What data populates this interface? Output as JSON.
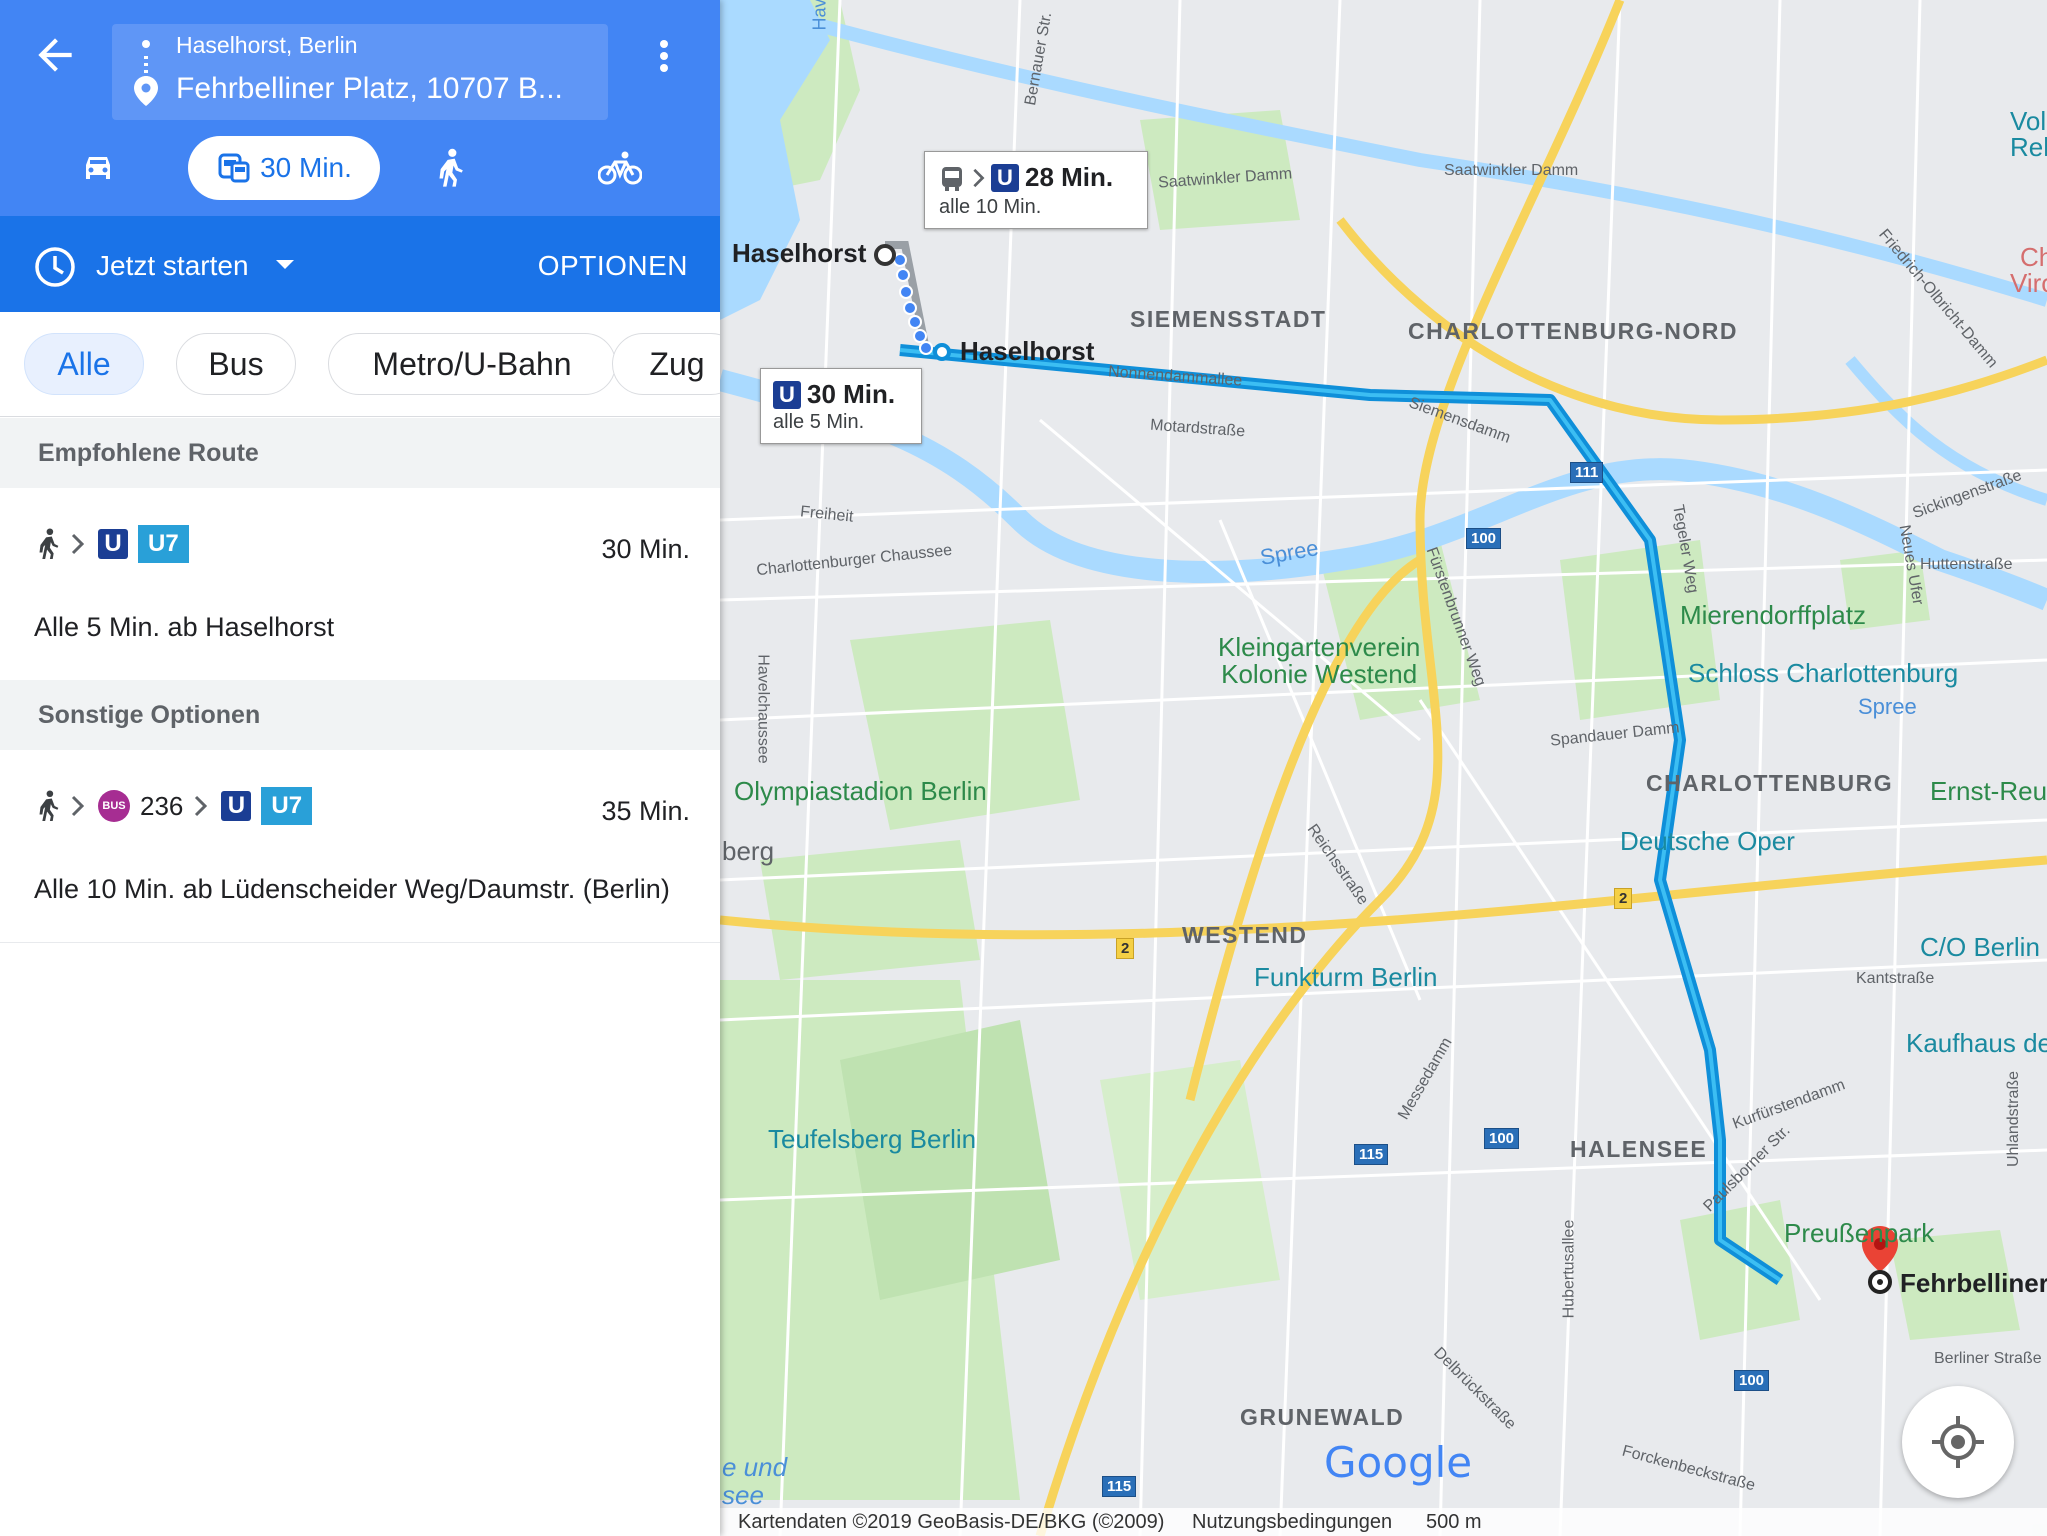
{
  "directions": {
    "origin": "Haselhorst, Berlin",
    "destination": "Fehrbelliner Platz, 10707 B...",
    "modes": [
      {
        "name": "driving",
        "icon": "car-icon"
      },
      {
        "name": "transit",
        "icon": "transit-icon",
        "label": "30 Min."
      },
      {
        "name": "walking",
        "icon": "walk-icon"
      },
      {
        "name": "cycling",
        "icon": "bicycle-icon"
      }
    ],
    "depart_label": "Jetzt starten",
    "options_label": "OPTIONEN",
    "filters": [
      "Alle",
      "Bus",
      "Metro/U-Bahn",
      "Zug"
    ]
  },
  "recommended": {
    "header": "Empfohlene Route",
    "route": {
      "line": "U7",
      "u": "U",
      "duration": "30 Min.",
      "desc": "Alle 5 Min. ab Haselhorst"
    }
  },
  "other": {
    "header": "Sonstige Optionen",
    "route": {
      "bus_badge": "BUS",
      "bus_line": "236",
      "line": "U7",
      "u": "U",
      "duration": "35 Min.",
      "desc": "Alle 10 Min. ab Lüdenscheider Weg/Daumstr. (Berlin)"
    }
  },
  "map": {
    "callout_top": {
      "u": "U",
      "time": "28 Min.",
      "freq": "alle 10 Min."
    },
    "callout_main": {
      "u": "U",
      "time": "30 Min.",
      "freq": "alle 5 Min."
    },
    "stop_origin": "Haselhorst",
    "stop_station": "Haselhorst",
    "dest": "Fehrbelliner",
    "districts": [
      "SIEMENSSTADT",
      "CHARLOTTENBURG-NORD",
      "CHARLOTTENBURG",
      "WESTEND",
      "HALENSEE",
      "GRUNEWALD"
    ],
    "streets": [
      "Saatwinkler Damm",
      "Saatwinkler Damm",
      "Nonnendammallee",
      "Motardstraße",
      "Siemensdamm",
      "Freiheit",
      "Charlottenburger Chaussee",
      "Spree",
      "Spree",
      "Fürstenbrunner Weg",
      "Spandauer Damm",
      "Havelchaussee",
      "Reichsstraße",
      "Messedamm",
      "Kurfürstendamm",
      "Paulsborner Str.",
      "Hubertusallee",
      "Delbrückstraße",
      "Forckenbeckstraße",
      "Berliner Straße",
      "Kantstraße",
      "Sickingenstraße",
      "Huttenstraße",
      "Tegeler Weg",
      "Neues Ufer",
      "Friedrich-Olbricht-Damm",
      "Bernauer Str.",
      "Uhlandstraße"
    ],
    "pois_green": [
      "Kleingartenverein\nKolonie Westend",
      "Olympiastadion Berlin",
      "Teufelsberg Berlin",
      "Mierendorffplatz",
      "Ernst-Reut",
      "Preußenpark"
    ],
    "pois_teal": [
      "Schloss Charlottenburg",
      "Deutsche Oper",
      "Funkturm Berlin",
      "C/O Berlin",
      "Kaufhaus de"
    ],
    "edge_text": [
      "Vol",
      "Reh",
      "Ch",
      "Viro",
      "berg",
      "e und",
      "see",
      "Hav"
    ],
    "highways": [
      "111",
      "100",
      "100",
      "100",
      "115",
      "115",
      "2",
      "2"
    ],
    "attribution": "Kartendaten ©2019 GeoBasis-DE/BKG (©2009)",
    "terms": "Nutzungsbedingungen",
    "scale": "500 m",
    "google": "Google"
  },
  "colors": {
    "header_blue": "#4285f4",
    "timebar_blue": "#1a73e8",
    "route_blue": "#0f8fd9",
    "u_blue": "#1b3e94",
    "u7_blue": "#29a0d8",
    "bus_purple": "#a62d92"
  }
}
